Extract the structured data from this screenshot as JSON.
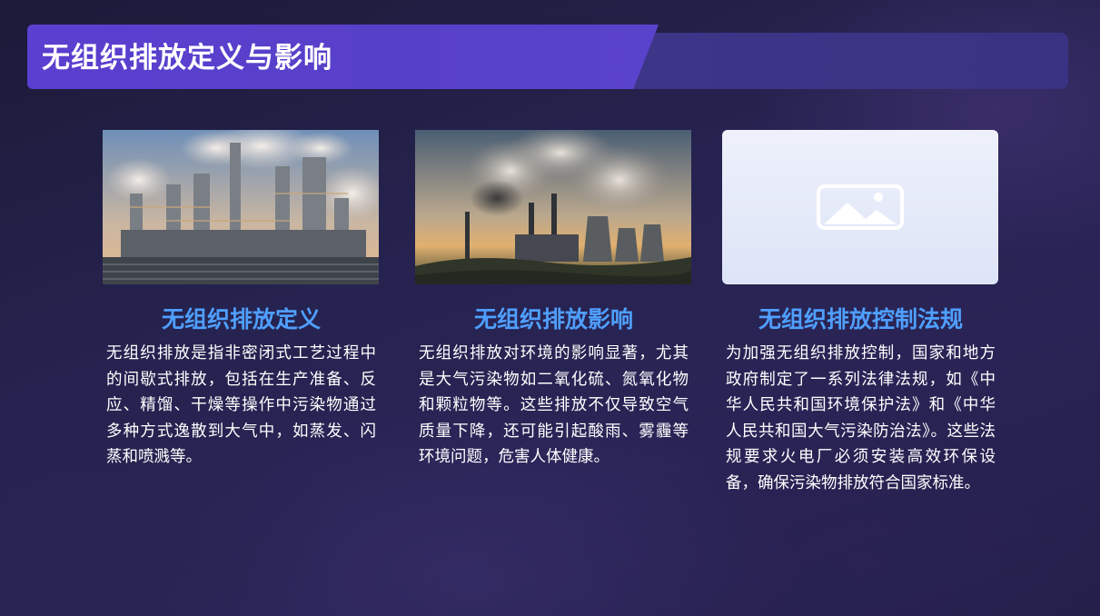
{
  "slide": {
    "title": "无组织排放定义与影响",
    "colors": {
      "title_bar": "#5740c8",
      "title_bar_track": "#3d3588",
      "heading": "#4f9fff",
      "background": "#262350",
      "body_text": "#ffffff"
    }
  },
  "cards": [
    {
      "image_icon": "refinery-photo",
      "heading": "无组织排放定义",
      "body": "无组织排放是指非密闭式工艺过程中的间歇式排放，包括在生产准备、反应、精馏、干燥等操作中污染物通过多种方式逸散到大气中，如蒸发、闪蒸和喷溅等。"
    },
    {
      "image_icon": "power-plant-photo",
      "heading": "无组织排放影响",
      "body": "无组织排放对环境的影响显著，尤其是大气污染物如二氧化硫、氮氧化物和颗粒物等。这些排放不仅导致空气质量下降，还可能引起酸雨、雾霾等环境问题，危害人体健康。"
    },
    {
      "image_icon": "image-placeholder-icon",
      "heading": "无组织排放控制法规",
      "body": "为加强无组织排放控制，国家和地方政府制定了一系列法律法规，如《中华人民共和国环境保护法》和《中华人民共和国大气污染防治法》。这些法规要求火电厂必须安装高效环保设备，确保污染物排放符合国家标准。"
    }
  ]
}
